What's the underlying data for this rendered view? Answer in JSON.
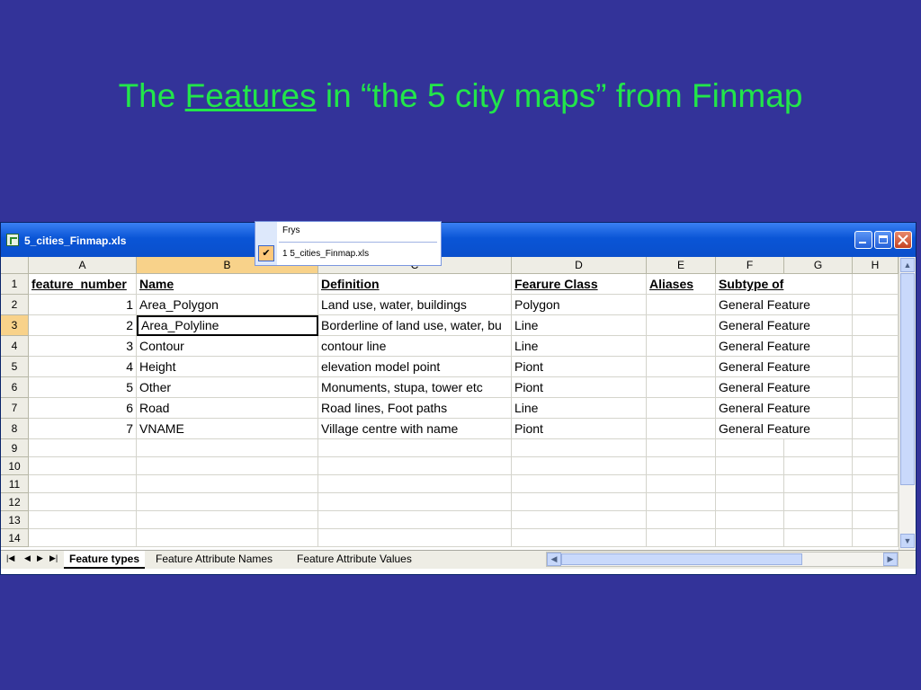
{
  "slide": {
    "title_before": "The ",
    "title_link": "Features",
    "title_after": " in “the 5 city maps” from Finmap"
  },
  "window": {
    "title": "5_cities_Finmap.xls"
  },
  "popup_menu": {
    "item1": "Frys",
    "item2": "1 5_cities_Finmap.xls"
  },
  "columns": [
    "A",
    "B",
    "C",
    "D",
    "E",
    "F",
    "G",
    "H"
  ],
  "rows": [
    "1",
    "2",
    "3",
    "4",
    "5",
    "6",
    "7",
    "8",
    "9",
    "10",
    "11",
    "12",
    "13",
    "14"
  ],
  "header_row": {
    "a": "feature_number",
    "b": "Name",
    "c": "Definition",
    "d": "Fearure Class",
    "e": "Aliases",
    "f": "Subtype of"
  },
  "data_rows": [
    {
      "num": "1",
      "name": "Area_Polygon",
      "definition": "Land use, water, buildings",
      "class": "Polygon",
      "subtype": "General Feature"
    },
    {
      "num": "2",
      "name": "Area_Polyline",
      "definition": "Borderline of land use, water, bu",
      "class": "Line",
      "subtype": "General Feature"
    },
    {
      "num": "3",
      "name": "Contour",
      "definition": "contour line",
      "class": "Line",
      "subtype": "General Feature"
    },
    {
      "num": "4",
      "name": "Height",
      "definition": "elevation model point",
      "class": "Piont",
      "subtype": "General Feature"
    },
    {
      "num": "5",
      "name": "Other",
      "definition": "Monuments, stupa, tower etc",
      "class": "Piont",
      "subtype": "General Feature"
    },
    {
      "num": "6",
      "name": "Road",
      "definition": "Road lines, Foot paths",
      "class": "Line",
      "subtype": "General Feature"
    },
    {
      "num": "7",
      "name": "VNAME",
      "definition": "Village centre with name",
      "class": "Piont",
      "subtype": "General Feature"
    }
  ],
  "sheet_tabs": [
    "Feature types",
    "Feature Attribute Names",
    "Feature  Attribute Values"
  ],
  "colors": {
    "background": "#333399",
    "title_green": "#22e64a",
    "selected_header": "#f8d28a"
  }
}
